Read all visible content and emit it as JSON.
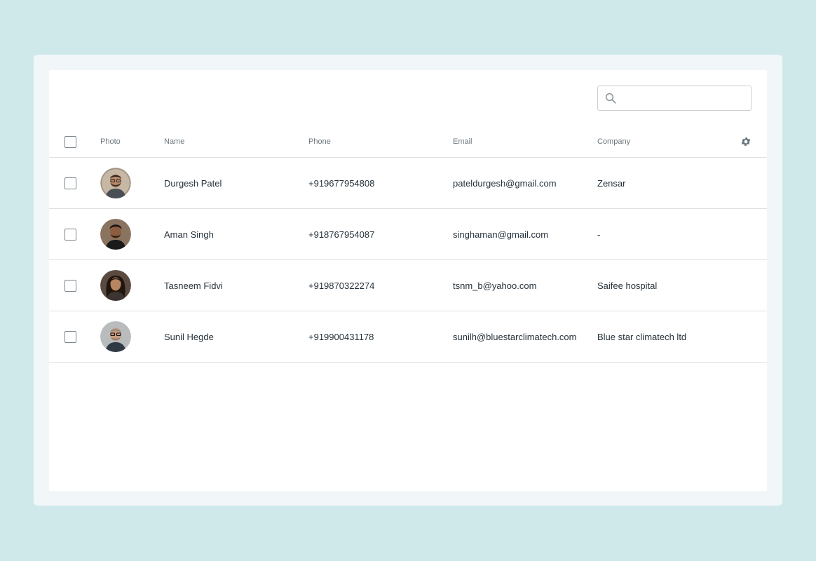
{
  "search": {
    "placeholder": "",
    "value": ""
  },
  "table": {
    "columns": {
      "photo": "Photo",
      "name": "Name",
      "phone": "Phone",
      "email": "Email",
      "company": "Company"
    },
    "rows": [
      {
        "name": "Durgesh Patel",
        "phone": "+919677954808",
        "email": "pateldurgesh@gmail.com",
        "company": "Zensar"
      },
      {
        "name": "Aman Singh",
        "phone": "+918767954087",
        "email": "singhaman@gmail.com",
        "company": "-"
      },
      {
        "name": "Tasneem Fidvi",
        "phone": "+919870322274",
        "email": "tsnm_b@yahoo.com",
        "company": "Saifee hospital"
      },
      {
        "name": "Sunil Hegde",
        "phone": "+919900431178",
        "email": "sunilh@bluestarclimatech.com",
        "company": "Blue star climatech ltd"
      }
    ]
  },
  "icons": {
    "search": "search-icon",
    "settings": "gear-icon"
  },
  "colors": {
    "page_bg": "#cfe9eb",
    "card_bg": "#f1f7f8",
    "panel_bg": "#ffffff",
    "divider": "#dde1e4"
  }
}
